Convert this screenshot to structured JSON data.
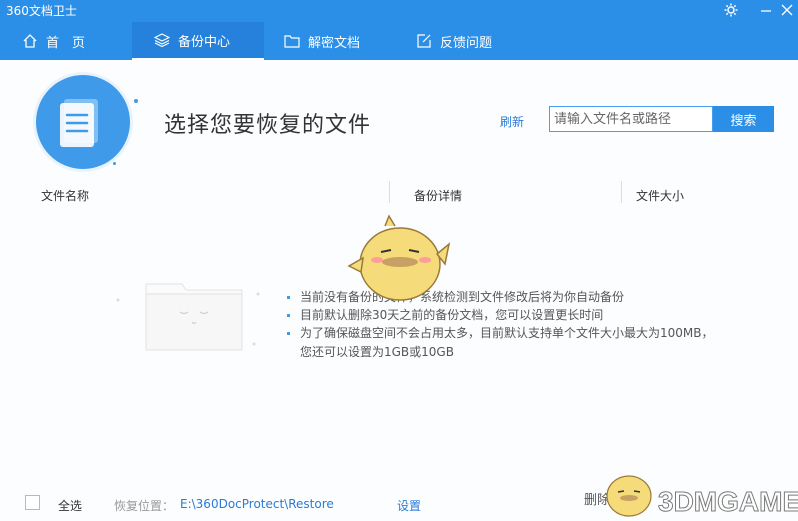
{
  "app": {
    "title": "360文档卫士"
  },
  "tabs": [
    {
      "label": "首　页",
      "icon": "home-icon",
      "active": false
    },
    {
      "label": "备份中心",
      "icon": "layers-icon",
      "active": true
    },
    {
      "label": "解密文档",
      "icon": "folder-icon",
      "active": false
    },
    {
      "label": "反馈问题",
      "icon": "edit-icon",
      "active": false
    }
  ],
  "main": {
    "headline": "选择您要恢复的文件",
    "refresh_label": "刷新",
    "search": {
      "placeholder": "请输入文件名或路径",
      "button_label": "搜索"
    }
  },
  "table": {
    "columns": [
      "文件名称",
      "备份详情",
      "文件大小"
    ]
  },
  "empty_state": {
    "lines": [
      "当前没有备份的文件，系统检测到文件修改后将为你自动备份",
      "目前默认删除30天之前的备份文档，您可以设置更长时间",
      "为了确保磁盘空间不会占用太多，目前默认支持单个文件大小最大为100MB，",
      "您还可以设置为1GB或10GB"
    ]
  },
  "footer": {
    "select_all_label": "全选",
    "restore_location_label": "恢复位置：",
    "restore_path": "E:\\360DocProtect\\Restore",
    "settings_label": "设置",
    "delete_label": "删除"
  },
  "watermark": {
    "text": "3DMGAME"
  },
  "colors": {
    "accent": "#2b8fe8",
    "tab_active": "#2581db",
    "link": "#2b7bd6"
  }
}
